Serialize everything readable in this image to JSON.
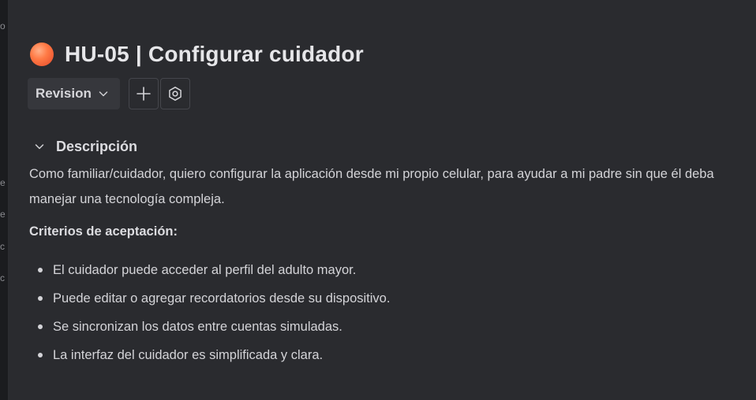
{
  "work_item": {
    "status_color": "#ff6a3d",
    "title": "HU-05 | Configurar cuidador"
  },
  "toolbar": {
    "status_label": "Revision",
    "status_icon": "chevron-down-icon",
    "add_icon": "plus-icon",
    "settings_icon": "hexagon-settings-icon"
  },
  "left_strip_glyphs": [
    "o",
    "e",
    "e",
    "c",
    "c"
  ],
  "description_section": {
    "title": "Descripción",
    "body": "Como familiar/cuidador, quiero configurar la aplicación desde mi propio celular, para ayudar a mi padre sin que él deba manejar una tecnología compleja.",
    "criteria_title": "Criterios de aceptación:",
    "criteria": [
      "El cuidador puede acceder al perfil del adulto mayor.",
      "Puede editar o agregar recordatorios desde su dispositivo.",
      "Se sincronizan los datos entre cuentas simuladas.",
      "La interfaz del cuidador es simplificada y clara."
    ]
  }
}
